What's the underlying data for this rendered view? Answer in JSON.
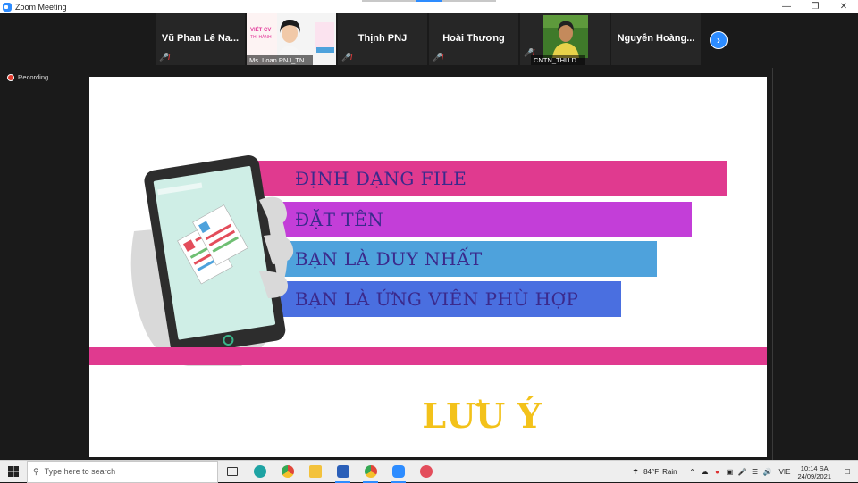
{
  "window": {
    "title": "Zoom Meeting"
  },
  "participants": [
    {
      "name": "Vũ Phan Lê Na..."
    },
    {
      "caption": "Ms. Loan PNJ_TN..."
    },
    {
      "name": "Thịnh PNJ"
    },
    {
      "name": "Hoài Thương"
    },
    {
      "caption": "CNTN_THU D..."
    },
    {
      "name": "Nguyễn Hoàng..."
    }
  ],
  "recording": {
    "label": "Recording"
  },
  "slide": {
    "bars": [
      {
        "text": "ĐỊNH DẠNG FILE",
        "color": "#e03a8f"
      },
      {
        "text": "ĐẶT TÊN",
        "color": "#c33ed8"
      },
      {
        "text": "BẠN LÀ DUY NHẤT",
        "color": "#4ea2dc"
      },
      {
        "text": "BẠN LÀ ỨNG VIÊN PHÙ HỢP",
        "color": "#4a6fe0"
      }
    ],
    "bottom_line_color": "#e03a8f",
    "note": "LƯU Ý",
    "note_color": "#f3c21a"
  },
  "taskbar": {
    "search_placeholder": "Type here to search",
    "apps": [
      "task-view-icon",
      "edge-icon",
      "chrome-icon",
      "file-explorer-icon",
      "word-icon",
      "chrome-profile-icon",
      "zoom-icon",
      "paint-icon"
    ],
    "weather": {
      "temp": "84°F",
      "condition": "Rain"
    },
    "language": "VIE",
    "time": "10:14 SA",
    "date": "24/09/2021"
  }
}
